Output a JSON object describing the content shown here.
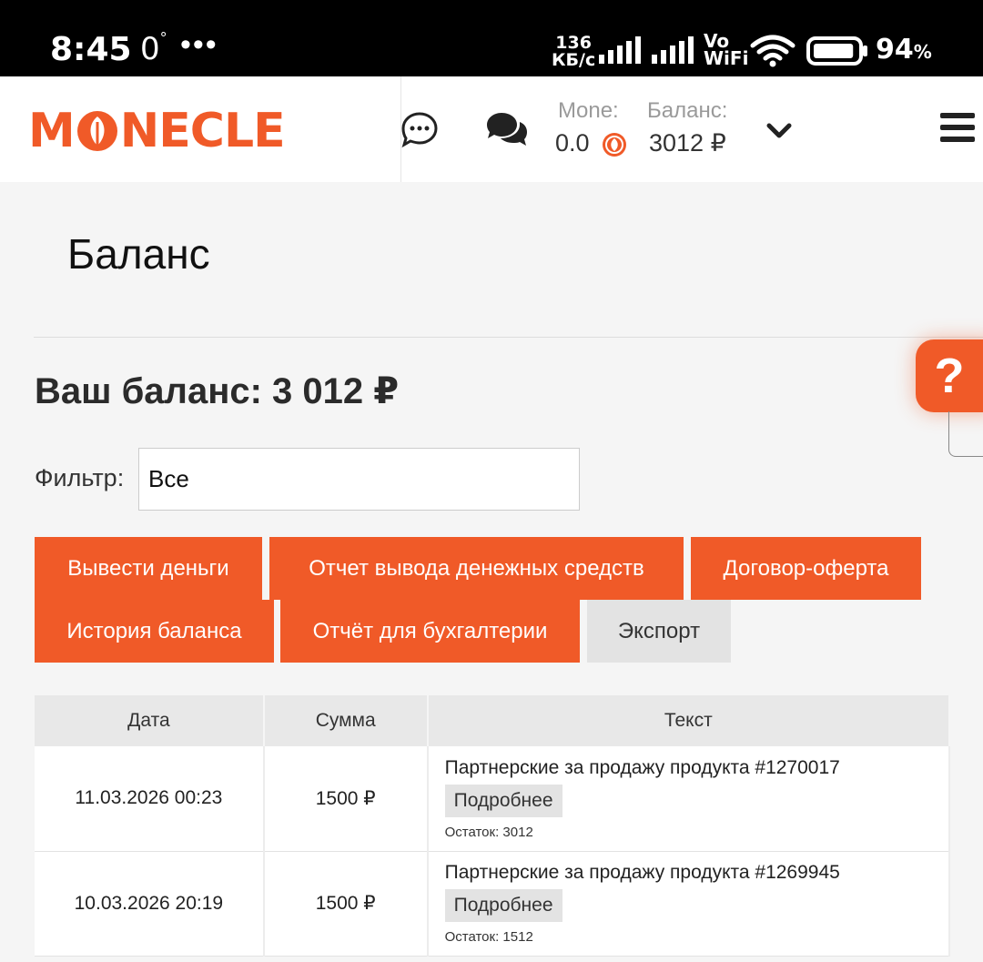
{
  "status_bar": {
    "time": "8:45",
    "notif_num": "0",
    "notif_sup": "°",
    "dots": "•••",
    "speed_value": "136",
    "speed_unit": "КБ/с",
    "vo": "Vo",
    "wifi_label": "WiFi",
    "battery_pct": "94",
    "pct_sign": "%",
    "battery_level": 0.94
  },
  "header": {
    "logo_left": "M",
    "logo_right": "NECLE",
    "mone_label": "Mone:",
    "mone_value": "0.0",
    "balance_label": "Баланс:",
    "balance_value": "3012 ₽",
    "brand_color": "#f05a28"
  },
  "page": {
    "title": "Баланс",
    "balance_line": "Ваш баланс: 3 012 ₽",
    "help_label": "?",
    "filter_label": "Фильтр:",
    "filter_value": "Все"
  },
  "buttons": [
    {
      "label": "Вывести деньги"
    },
    {
      "label": "Отчет вывода денежных средств"
    },
    {
      "label": "Договор-оферта"
    },
    {
      "label": "История баланса"
    },
    {
      "label": "Отчёт для бухгалтерии"
    },
    {
      "label": "Экспорт"
    }
  ],
  "table": {
    "headers": [
      "Дата",
      "Сумма",
      "Текст"
    ],
    "rows": [
      {
        "date": "11.03.2026 00:23",
        "amount": "1500 ₽",
        "text": "Партнерские за продажу продукта #1270017",
        "more": "Подробнее",
        "remainder": "Остаток: 3012"
      },
      {
        "date": "10.03.2026 20:19",
        "amount": "1500 ₽",
        "text": "Партнерские за продажу продукта #1269945",
        "more": "Подробнее",
        "remainder": "Остаток: 1512"
      }
    ]
  }
}
